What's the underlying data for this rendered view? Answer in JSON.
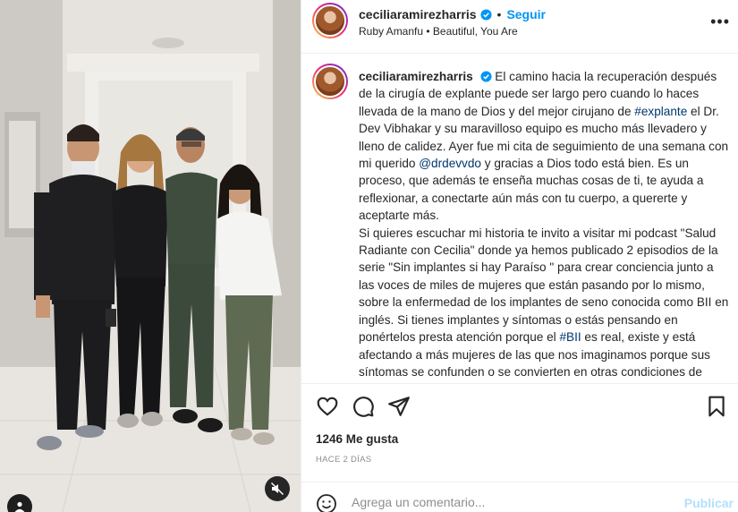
{
  "post": {
    "username": "ceciliaramirezharris",
    "follow_label": "Seguir",
    "separator": "•",
    "music": "Ruby Amanfu • Beautiful, You Are",
    "more_label": "•••"
  },
  "caption": {
    "username": "ceciliaramirezharris",
    "p1_a": "El camino hacia la recuperación después de la cirugía de explante puede ser largo pero cuando lo haces llevada de la mano de Dios y del mejor cirujano de ",
    "p1_tag": "#explante",
    "p1_b": " el Dr. Dev Vibhakar y su maravilloso equipo es mucho más llevadero y lleno de calidez. Ayer fue mi cita de seguimiento de una semana con mi querido ",
    "p1_mention": "@drdevvdo",
    "p1_c": " y gracias a Dios todo está bien. Es un proceso, que además te enseña muchas cosas de ti, te ayuda a reflexionar, a conectarte aún más con tu cuerpo, a quererte y aceptarte más.",
    "p2_a": "Si quieres escuchar mi historia te invito a visitar mi podcast \"Salud Radiante con Cecilia\" donde ya hemos publicado 2 episodios de la serie \"Sin implantes si hay Paraíso \" para crear conciencia junto a las voces de miles de mujeres que están pasando por lo mismo, sobre la enfermedad de los implantes de seno conocida como BII en inglés. Si tienes implantes y síntomas o estás pensando en ponértelos presta atención porque el ",
    "p2_tag": "#BII",
    "p2_b": " es real, existe y está afectando a más mujeres de las que nos imaginamos porque sus síntomas se confunden o se convierten en otras condiciones de salud como me pasó a mi con mi"
  },
  "stats": {
    "likes": "1246 Me gusta",
    "time_ago": "HACE 2 DÍAS"
  },
  "comment": {
    "placeholder": "Agrega un comentario...",
    "post_label": "Publicar"
  },
  "icons": {
    "like": "heart-icon",
    "comment": "comment-icon",
    "share": "send-icon",
    "save": "bookmark-icon",
    "verified": "verified-badge-icon",
    "emoji": "emoji-icon",
    "mute": "muted-speaker-icon",
    "tagged_user": "user-tag-icon"
  },
  "colors": {
    "link": "#0095f6",
    "hashtag": "#00376b",
    "muted_text": "#8e8e8e",
    "post_disabled": "#b2dffc"
  }
}
